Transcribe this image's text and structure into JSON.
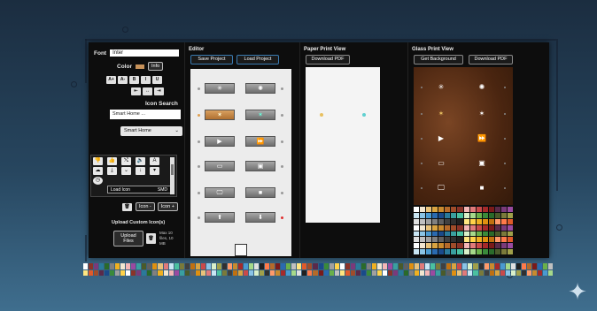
{
  "panel": {
    "font_label": "Font",
    "font_value": "Inter",
    "color_label": "Color",
    "color_swatch": "#c7925a",
    "info_button": "Info",
    "format_buttons": [
      "A+",
      "A-",
      "B",
      "I",
      "U"
    ],
    "align_buttons": [
      "⇤",
      "↔",
      "⇥"
    ],
    "icon_search_label": "Icon Search",
    "icon_search_value": "Smart Home ...",
    "category_select": "Smart Home",
    "load_icon_label": "Load Icon",
    "load_icon_format": "SMD",
    "icon_size_buttons": [
      "Icon -",
      "Icon +"
    ],
    "upload_label": "Upload Custom Icon(s)",
    "upload_button": "Upload Files",
    "upload_note": "Max 10 files, 10 MB"
  },
  "editor": {
    "title": "Editor",
    "save_button": "Save Project",
    "load_button": "Load Project",
    "rows": [
      {
        "left": "✳",
        "right": "✺"
      },
      {
        "left": "✶",
        "right": "✶"
      },
      {
        "left": "▶",
        "right": "⏩"
      },
      {
        "left": "▭",
        "right": "▣"
      },
      {
        "left": "🖵",
        "right": "■"
      },
      {
        "left": "⬆",
        "right": "⬇"
      }
    ]
  },
  "paper": {
    "title": "Paper Print View",
    "download_button": "Download PDF"
  },
  "glass": {
    "title": "Glass Print View",
    "background_button": "Get Background",
    "download_button": "Download PDF",
    "icons": [
      {
        "left": "✳",
        "right": "✺"
      },
      {
        "left": "✶",
        "right": "✶"
      },
      {
        "left": "▶",
        "right": "⏩"
      },
      {
        "left": "▭",
        "right": "▣"
      },
      {
        "left": "🖵",
        "right": "■"
      }
    ]
  },
  "palette_colors": [
    "#ffffff",
    "#f2e6d0",
    "#e8c27a",
    "#d9a441",
    "#c98a2e",
    "#b56a2a",
    "#a04c2a",
    "#8a3328",
    "#f4b6b6",
    "#e07a7a",
    "#c94a4a",
    "#a52a2a",
    "#7a1a1a",
    "#5a2a4a",
    "#7a3a7a",
    "#9a4aa0",
    "#c9e6f4",
    "#8ac4e6",
    "#4a9ad0",
    "#2a6ab0",
    "#1a4a8a",
    "#2a7a9a",
    "#3aa0a0",
    "#4ac0a0",
    "#d9f0c9",
    "#a6d98a",
    "#6ab04a",
    "#3a8a3a",
    "#2a6a2a",
    "#4a5a2a",
    "#7a7a3a",
    "#a0a04a",
    "#e0e0e0",
    "#c0c0c0",
    "#a0a0a0",
    "#808080",
    "#606060",
    "#404040",
    "#303030",
    "#202020",
    "#ffe680",
    "#ffd24a",
    "#f0b020",
    "#e09010",
    "#c07010",
    "#ff9a6a",
    "#ff7a4a",
    "#e05a2a"
  ]
}
